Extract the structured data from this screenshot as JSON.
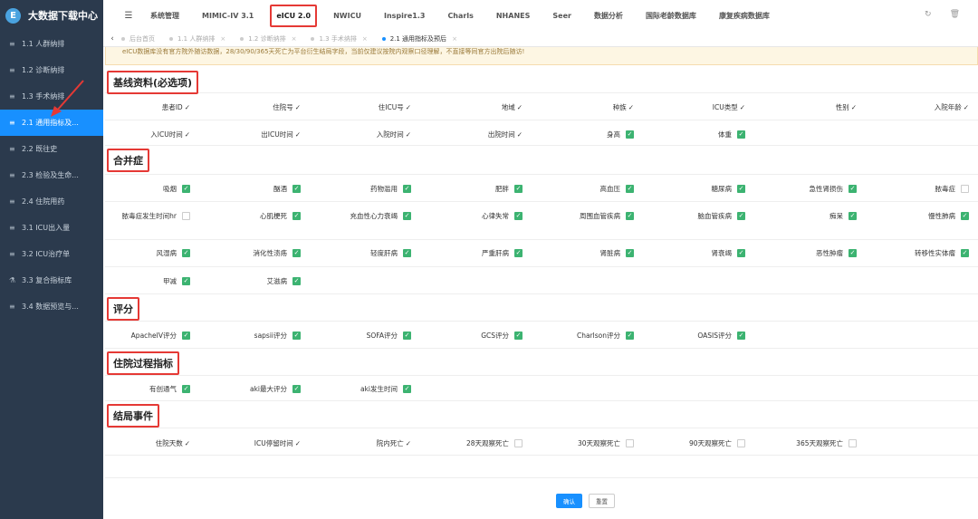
{
  "brand": {
    "logo_glyph": "E",
    "title": "大数据下载中心"
  },
  "sidebar": {
    "items": [
      {
        "label": "1.1 人群纳排",
        "icon": "list-icon",
        "active": false
      },
      {
        "label": "1.2 诊断纳排",
        "icon": "list-icon",
        "active": false
      },
      {
        "label": "1.3 手术纳排",
        "icon": "list-icon",
        "active": false
      },
      {
        "label": "2.1 通用指标及...",
        "icon": "list-icon",
        "active": true
      },
      {
        "label": "2.2 既往史",
        "icon": "list-icon",
        "active": false
      },
      {
        "label": "2.3 检验及生命...",
        "icon": "list-icon",
        "active": false
      },
      {
        "label": "2.4 住院用药",
        "icon": "list-icon",
        "active": false
      },
      {
        "label": "3.1 ICU出入量",
        "icon": "list-icon",
        "active": false
      },
      {
        "label": "3.2 ICU治疗单",
        "icon": "list-icon",
        "active": false
      },
      {
        "label": "3.3 复合指标库",
        "icon": "flask-icon",
        "active": false
      },
      {
        "label": "3.4 数据预览与...",
        "icon": "list-icon",
        "active": false
      }
    ]
  },
  "topnav": {
    "items": [
      {
        "label": "系统管理",
        "active": false
      },
      {
        "label": "MIMIC-IV 3.1",
        "active": false
      },
      {
        "label": "eICU 2.0",
        "active": true
      },
      {
        "label": "NWICU",
        "active": false
      },
      {
        "label": "Inspire1.3",
        "active": false
      },
      {
        "label": "Charls",
        "active": false
      },
      {
        "label": "NHANES",
        "active": false
      },
      {
        "label": "Seer",
        "active": false
      },
      {
        "label": "数据分析",
        "active": false
      },
      {
        "label": "国际老龄数据库",
        "active": false
      },
      {
        "label": "康复疾病数据库",
        "active": false
      }
    ],
    "refresh_glyph": "↻",
    "delete_glyph": "🗑"
  },
  "tabs": {
    "back_glyph": "‹",
    "items": [
      {
        "label": "后台首页",
        "active": false,
        "closable": false
      },
      {
        "label": "1.1 人群纳排",
        "active": false,
        "closable": true
      },
      {
        "label": "1.2 诊断纳排",
        "active": false,
        "closable": true
      },
      {
        "label": "1.3 手术纳排",
        "active": false,
        "closable": true
      },
      {
        "label": "2.1 通用指标及预后",
        "active": true,
        "closable": true
      }
    ],
    "close_glyph": "×"
  },
  "notice": "eICU数据库没有官方院外随访数据，28/30/90/365天死亡为平台衍生结局字段，当前仅建议按院内观察口径理解，不直接等同官方出院后随访!",
  "sections": {
    "baseline": "基线资料(必选项)",
    "comorbidity": "合并症",
    "score": "评分",
    "process": "住院过程指标",
    "outcome": "结局事件"
  },
  "baseline_fields": [
    {
      "label": "患者ID",
      "mark": "✓"
    },
    {
      "label": "住院号",
      "mark": "✓"
    },
    {
      "label": "住ICU号",
      "mark": "✓"
    },
    {
      "label": "地域",
      "mark": "✓"
    },
    {
      "label": "种族",
      "mark": "✓"
    },
    {
      "label": "ICU类型",
      "mark": "✓"
    },
    {
      "label": "性别",
      "mark": "✓"
    },
    {
      "label": "入院年龄",
      "mark": "✓"
    },
    {
      "label": "入ICU时间",
      "mark": "✓"
    },
    {
      "label": "出ICU时间",
      "mark": "✓"
    },
    {
      "label": "入院时间",
      "mark": "✓"
    },
    {
      "label": "出院时间",
      "mark": "✓"
    },
    {
      "label": "身高",
      "checked": true
    },
    {
      "label": "体重",
      "checked": true
    }
  ],
  "comorbidity_fields": [
    {
      "label": "吸烟",
      "checked": true
    },
    {
      "label": "酗酒",
      "checked": true
    },
    {
      "label": "药物滥用",
      "checked": true
    },
    {
      "label": "肥胖",
      "checked": true
    },
    {
      "label": "高血压",
      "checked": true
    },
    {
      "label": "糖尿病",
      "checked": true
    },
    {
      "label": "急性肾损伤",
      "checked": true
    },
    {
      "label": "脓毒症",
      "checked": false
    },
    {
      "label": "脓毒症发生时间hr",
      "checked": false
    },
    {
      "label": "心肌梗死",
      "checked": true
    },
    {
      "label": "充血性心力衰竭",
      "checked": true
    },
    {
      "label": "心律失常",
      "checked": true
    },
    {
      "label": "周围血管疾病",
      "checked": true
    },
    {
      "label": "脑血管疾病",
      "checked": true
    },
    {
      "label": "痴呆",
      "checked": true
    },
    {
      "label": "慢性肺病",
      "checked": true
    },
    {
      "label": "风湿病",
      "checked": true
    },
    {
      "label": "消化性溃疡",
      "checked": true
    },
    {
      "label": "轻度肝病",
      "checked": true
    },
    {
      "label": "严重肝病",
      "checked": true
    },
    {
      "label": "肾脏病",
      "checked": true
    },
    {
      "label": "肾衰竭",
      "checked": true
    },
    {
      "label": "恶性肿瘤",
      "checked": true
    },
    {
      "label": "转移性实体瘤",
      "checked": true
    },
    {
      "label": "甲减",
      "checked": true
    },
    {
      "label": "艾滋病",
      "checked": true
    }
  ],
  "score_fields": [
    {
      "label": "ApacheIV评分",
      "checked": true
    },
    {
      "label": "sapsii评分",
      "checked": true
    },
    {
      "label": "SOFA评分",
      "checked": true
    },
    {
      "label": "GCS评分",
      "checked": true
    },
    {
      "label": "Charlson评分",
      "checked": true
    },
    {
      "label": "OASIS评分",
      "checked": true
    }
  ],
  "process_fields": [
    {
      "label": "有创通气",
      "checked": true
    },
    {
      "label": "aki最大评分",
      "checked": true
    },
    {
      "label": "aki发生时间",
      "checked": true
    }
  ],
  "outcome_fields": [
    {
      "label": "住院天数",
      "mark": "✓"
    },
    {
      "label": "ICU停留时间",
      "mark": "✓"
    },
    {
      "label": "院内死亡",
      "mark": "✓"
    },
    {
      "label": "28天观察死亡",
      "checked": false
    },
    {
      "label": "30天观察死亡",
      "checked": false
    },
    {
      "label": "90天观察死亡",
      "checked": false
    },
    {
      "label": "365天观察死亡",
      "checked": false
    }
  ],
  "buttons": {
    "confirm": "确认",
    "reset": "重置"
  },
  "colors": {
    "sidebar_bg": "#2b3a4d",
    "accent": "#1890ff",
    "check_green": "#3cb371",
    "annotation_red": "#e53935"
  }
}
